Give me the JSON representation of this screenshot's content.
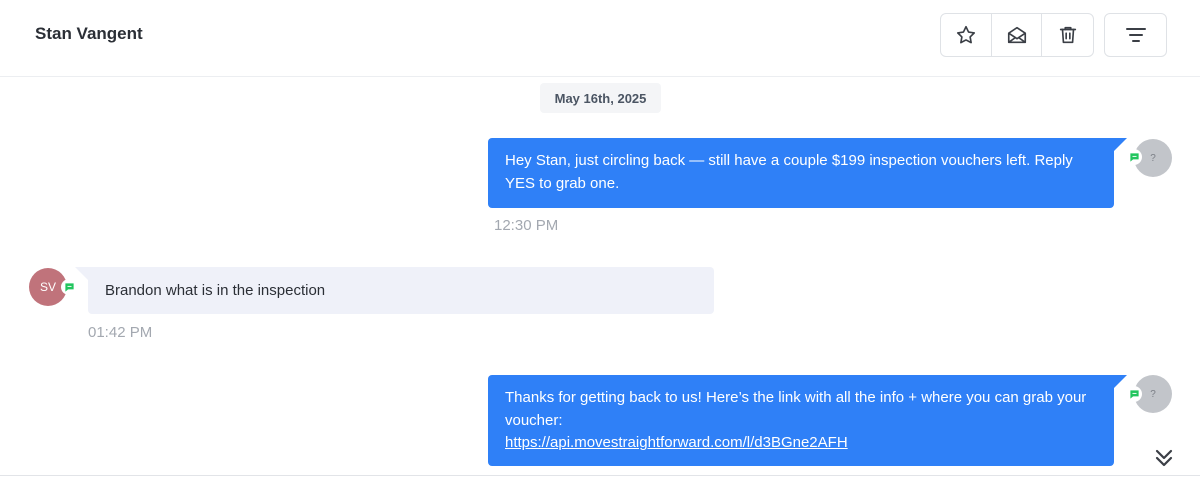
{
  "conversation": {
    "contact_name": "Stan Vangent"
  },
  "toolbar": {
    "icons": [
      "star-icon",
      "envelope-open-icon",
      "trash-icon",
      "filter-icon"
    ]
  },
  "thread": {
    "date_divider": "May 16th, 2025",
    "messages": [
      {
        "direction": "outbound",
        "avatar_text": "?",
        "text": "Hey Stan, just circling back — still have a couple $199 inspection vouchers left. Reply YES to grab one.",
        "time": "12:30 PM"
      },
      {
        "direction": "inbound",
        "avatar_text": "SV",
        "text": "Brandon what is in the inspection",
        "time": "01:42 PM"
      },
      {
        "direction": "outbound",
        "avatar_text": "?",
        "text": "Thanks for getting back to us! Here’s the link with all the info + where you can grab your voucher:",
        "link": "https://api.movestraightforward.com/l/d3BGne2AFH"
      }
    ]
  },
  "colors": {
    "outbound_bubble": "#2f80f7",
    "inbound_bubble": "#eff1f9",
    "channel_icon": "#22c55e"
  }
}
